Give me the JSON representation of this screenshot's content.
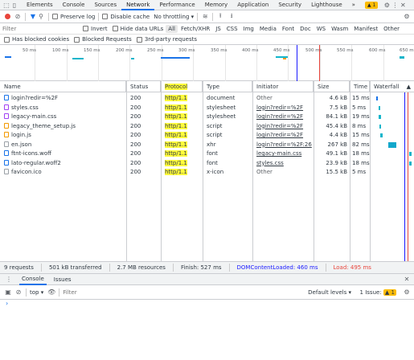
{
  "tabs": [
    "Elements",
    "Console",
    "Sources",
    "Network",
    "Performance",
    "Memory",
    "Application",
    "Security",
    "Lighthouse"
  ],
  "active_tab": "Network",
  "more_tabs": "»",
  "issue_count": "1",
  "toolbar": {
    "preserve_log": "Preserve log",
    "disable_cache": "Disable cache",
    "throttling": "No throttling"
  },
  "filter": {
    "placeholder": "Filter",
    "invert": "Invert",
    "hide_data_urls": "Hide data URLs",
    "types": [
      "All",
      "Fetch/XHR",
      "JS",
      "CSS",
      "Img",
      "Media",
      "Font",
      "Doc",
      "WS",
      "Wasm",
      "Manifest",
      "Other"
    ],
    "active_type": "All"
  },
  "options": {
    "blocked_cookies": "Has blocked cookies",
    "blocked_requests": "Blocked Requests",
    "third_party": "3rd-party requests"
  },
  "overview_ticks": [
    "50 ms",
    "100 ms",
    "150 ms",
    "200 ms",
    "250 ms",
    "300 ms",
    "350 ms",
    "400 ms",
    "450 ms",
    "500 ms",
    "550 ms",
    "600 ms",
    "650 m"
  ],
  "columns": {
    "name": "Name",
    "status": "Status",
    "protocol": "Protocol",
    "type": "Type",
    "initiator": "Initiator",
    "size": "Size",
    "time": "Time",
    "waterfall": "Waterfall"
  },
  "requests": [
    {
      "name": "login?redir=%2F",
      "status": "200",
      "protocol": "http/1.1",
      "type": "document",
      "initiator": "Other",
      "initiator_link": false,
      "size": "4.6 kB",
      "time": "15 ms"
    },
    {
      "name": "styles.css",
      "status": "200",
      "protocol": "http/1.1",
      "type": "stylesheet",
      "initiator": "login?redir=%2F",
      "initiator_link": true,
      "size": "7.5 kB",
      "time": "5 ms"
    },
    {
      "name": "legacy-main.css",
      "status": "200",
      "protocol": "http/1.1",
      "type": "stylesheet",
      "initiator": "login?redir=%2F",
      "initiator_link": true,
      "size": "84.1 kB",
      "time": "19 ms"
    },
    {
      "name": "legacy_theme_setup.js",
      "status": "200",
      "protocol": "http/1.1",
      "type": "script",
      "initiator": "login?redir=%2F",
      "initiator_link": true,
      "size": "45.4 kB",
      "time": "8 ms"
    },
    {
      "name": "login.js",
      "status": "200",
      "protocol": "http/1.1",
      "type": "script",
      "initiator": "login?redir=%2F",
      "initiator_link": true,
      "size": "4.4 kB",
      "time": "15 ms"
    },
    {
      "name": "en.json",
      "status": "200",
      "protocol": "http/1.1",
      "type": "xhr",
      "initiator": "login?redir=%2F:26",
      "initiator_link": true,
      "size": "267 kB",
      "time": "82 ms"
    },
    {
      "name": "ftnt-icons.woff",
      "status": "200",
      "protocol": "http/1.1",
      "type": "font",
      "initiator": "legacy-main.css",
      "initiator_link": true,
      "size": "49.1 kB",
      "time": "18 ms"
    },
    {
      "name": "lato-regular.woff2",
      "status": "200",
      "protocol": "http/1.1",
      "type": "font",
      "initiator": "styles.css",
      "initiator_link": true,
      "size": "23.9 kB",
      "time": "18 ms"
    },
    {
      "name": "favicon.ico",
      "status": "200",
      "protocol": "http/1.1",
      "type": "x-icon",
      "initiator": "Other",
      "initiator_link": false,
      "size": "15.5 kB",
      "time": "5 ms"
    }
  ],
  "summary": {
    "requests": "9 requests",
    "transferred": "501 kB transferred",
    "resources": "2.7 MB resources",
    "finish": "Finish: 527 ms",
    "dcl": "DOMContentLoaded: 460 ms",
    "load": "Load: 495 ms"
  },
  "drawer": {
    "tabs": [
      "Console",
      "Issues"
    ],
    "active": "Console",
    "context": "top",
    "filter_placeholder": "Filter",
    "levels": "Default levels",
    "issues": "1 Issue:",
    "issues_count": "1",
    "prompt": "›"
  },
  "colors": {
    "accent": "#1a73e8",
    "highlight": "#fffb3b",
    "dcl": "#1a1aff",
    "load": "#e8453c"
  }
}
